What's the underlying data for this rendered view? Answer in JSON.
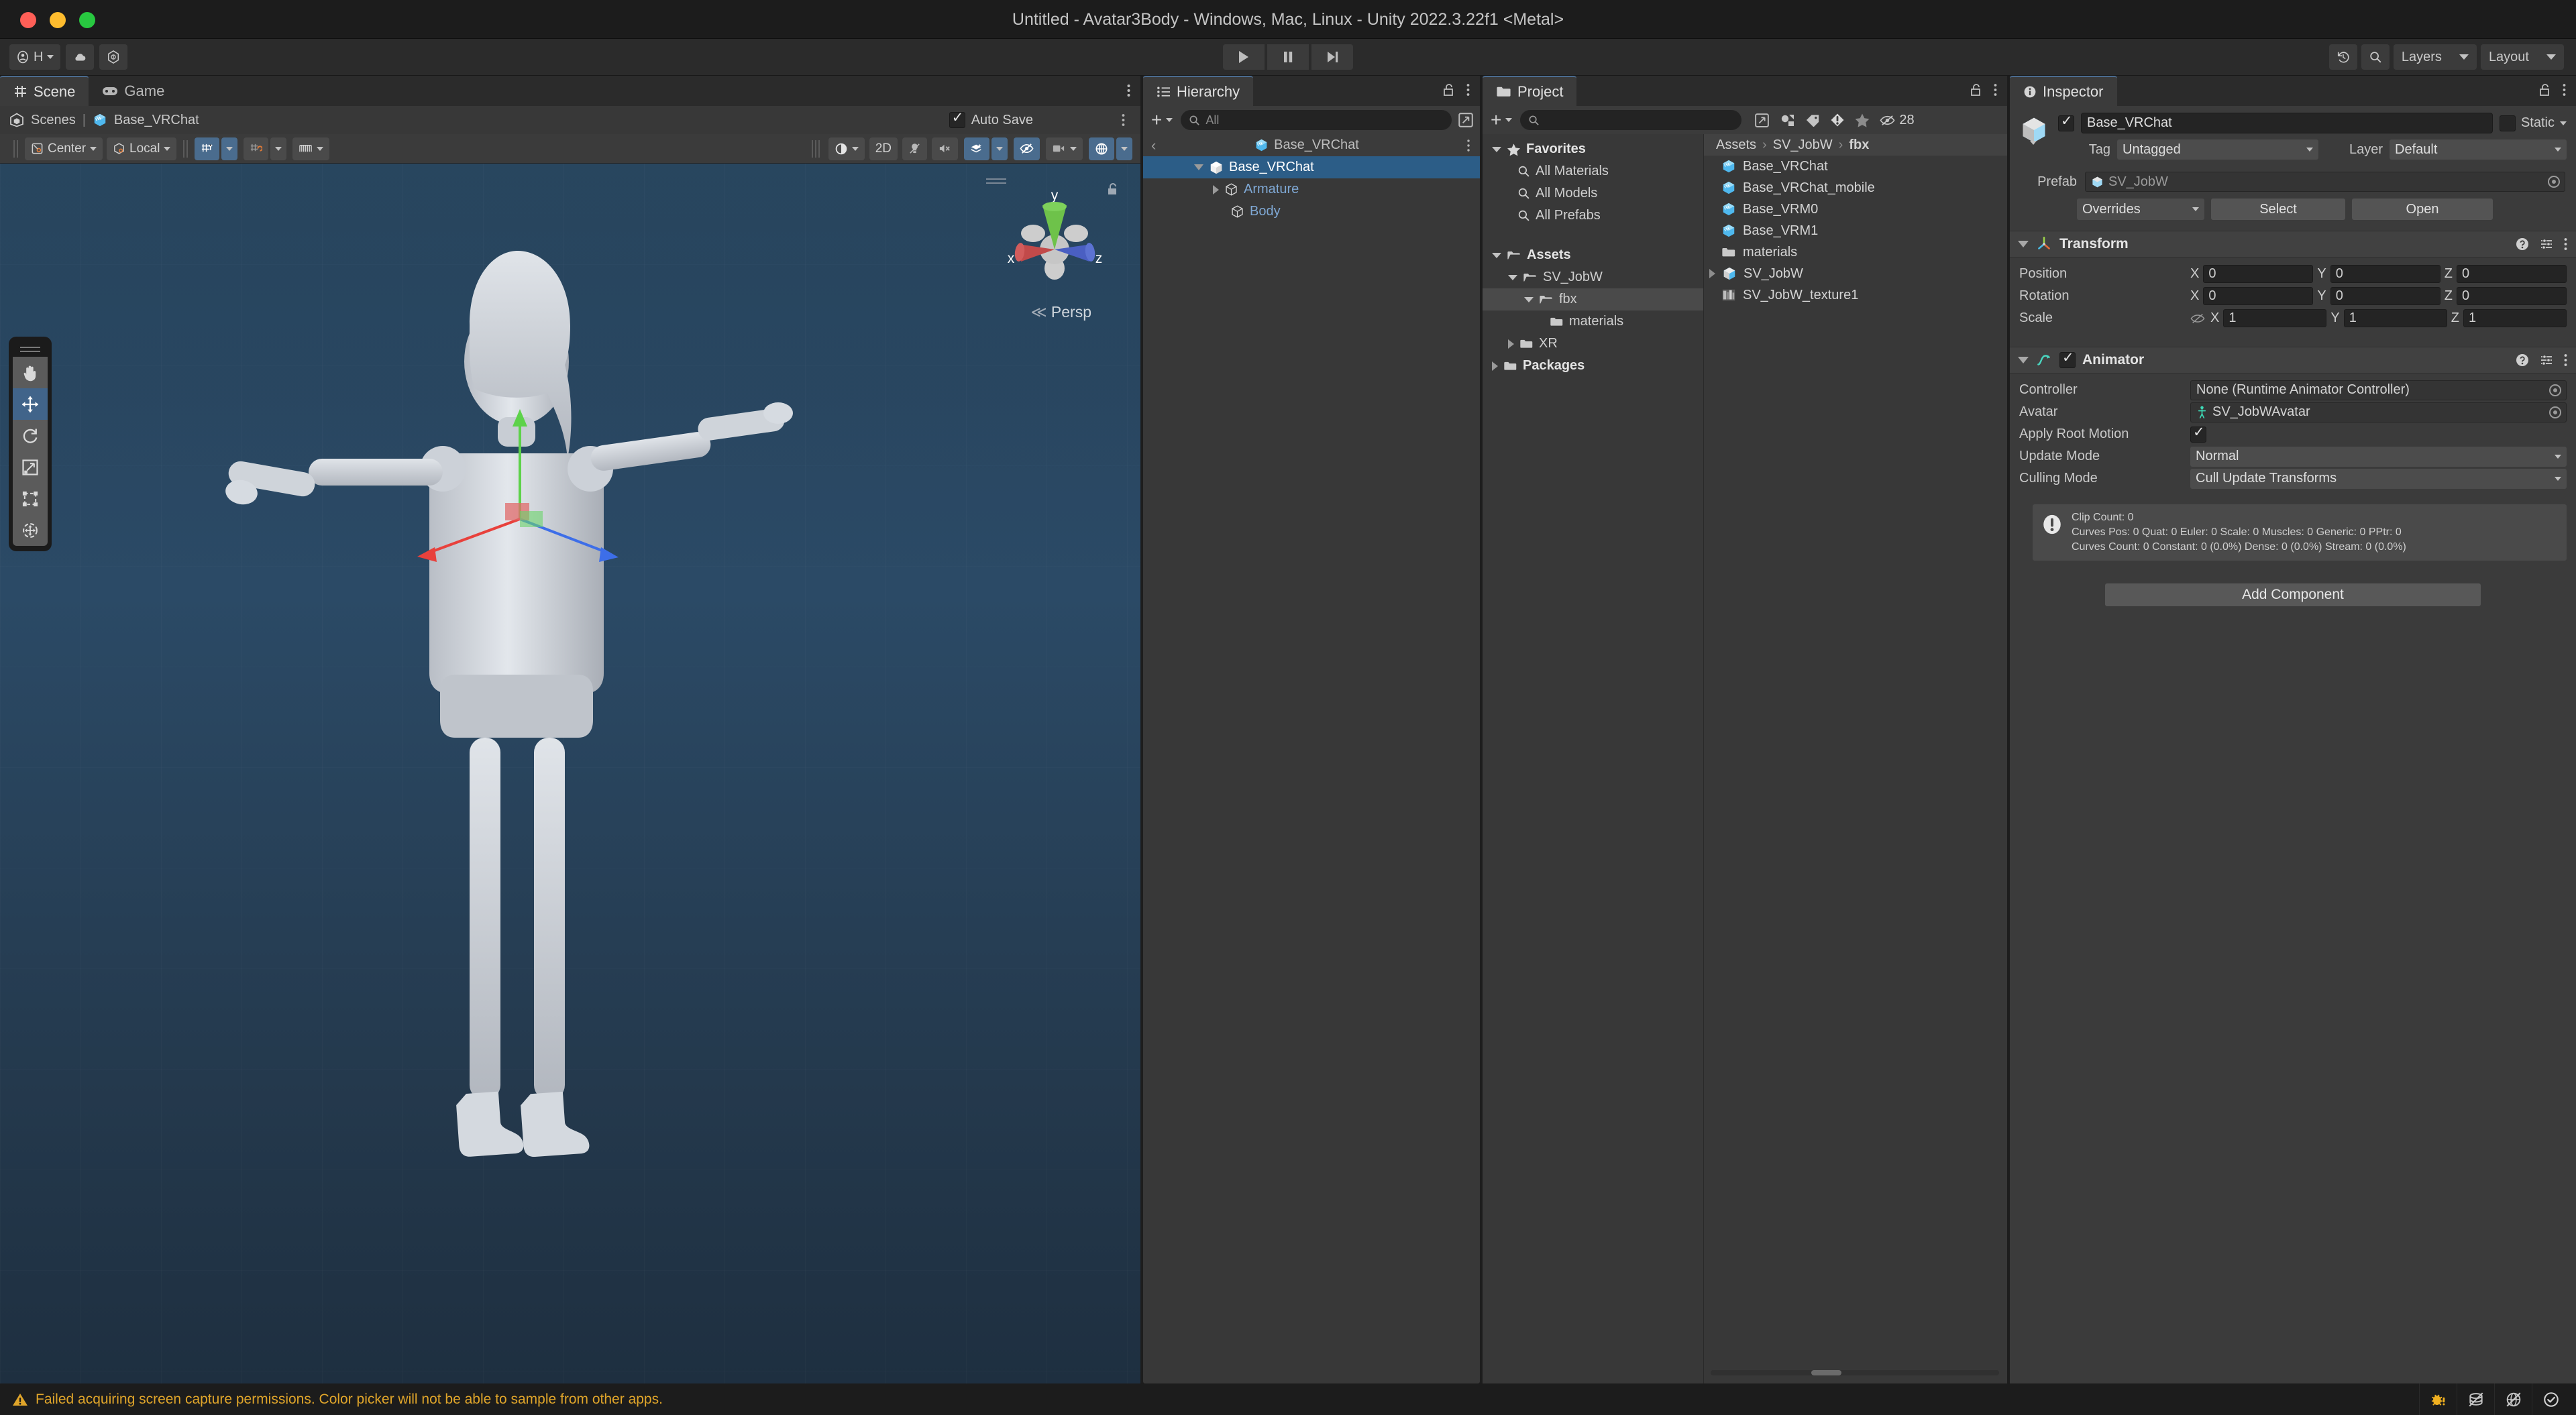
{
  "window": {
    "title": "Untitled - Avatar3Body - Windows, Mac, Linux - Unity 2022.3.22f1 <Metal>"
  },
  "toolbar": {
    "account_label": "H",
    "cloud_icon": "cloud-icon",
    "services_icon": "unity-services-icon",
    "play_icon": "play-icon",
    "pause_icon": "pause-icon",
    "step_icon": "step-icon",
    "history_icon": "undo-history-icon",
    "search_icon": "search-icon",
    "layers_label": "Layers",
    "layout_label": "Layout"
  },
  "scene": {
    "tabs": [
      {
        "label": "Scene",
        "icon": "scene-grid-icon",
        "active": true
      },
      {
        "label": "Game",
        "icon": "gamepad-icon",
        "active": false
      }
    ],
    "breadcrumb": {
      "scenes": "Scenes",
      "separator": "|",
      "current": "Base_VRChat"
    },
    "auto_save_label": "Auto Save",
    "auto_save_checked": true,
    "pivot_label": "Center",
    "space_label": "Local",
    "two_d_label": "2D",
    "persp_label": "Persp",
    "gizmo_axes": {
      "x": "x",
      "y": "y",
      "z": "z"
    },
    "tools": [
      {
        "name": "hand-tool",
        "active": false
      },
      {
        "name": "move-tool",
        "active": true
      },
      {
        "name": "rotate-tool",
        "active": false
      },
      {
        "name": "scale-tool",
        "active": false
      },
      {
        "name": "rect-tool",
        "active": false
      },
      {
        "name": "transform-tool",
        "active": false
      }
    ],
    "view_toggles": [
      {
        "name": "shading-mode",
        "active": false
      },
      {
        "name": "2d-toggle",
        "active": false
      },
      {
        "name": "lighting-toggle",
        "active": false
      },
      {
        "name": "audio-toggle",
        "active": false
      },
      {
        "name": "fx-toggle",
        "active": true
      },
      {
        "name": "hidden-objects-toggle",
        "active": true
      },
      {
        "name": "camera-toggle",
        "active": false
      },
      {
        "name": "gizmos-toggle",
        "active": true
      }
    ]
  },
  "hierarchy": {
    "tab_label": "Hierarchy",
    "search_placeholder": "All",
    "rows": [
      {
        "label": "Base_VRChat",
        "type": "scene",
        "depth": 0,
        "selected": false,
        "expandable": false
      },
      {
        "label": "Base_VRChat",
        "type": "prefab",
        "depth": 1,
        "selected": true,
        "expandable": true,
        "expanded": true
      },
      {
        "label": "Armature",
        "type": "gameobject",
        "depth": 2,
        "selected": false,
        "expandable": true,
        "expanded": false
      },
      {
        "label": "Body",
        "type": "gameobject",
        "depth": 2,
        "selected": false,
        "expandable": false
      }
    ]
  },
  "project": {
    "tab_label": "Project",
    "search_placeholder": "",
    "hidden_count": "28",
    "tree": [
      {
        "label": "Favorites",
        "depth": 0,
        "icon": "star-icon",
        "bold": true,
        "expanded": true
      },
      {
        "label": "All Materials",
        "depth": 1,
        "icon": "search-icon",
        "bold": false
      },
      {
        "label": "All Models",
        "depth": 1,
        "icon": "search-icon",
        "bold": false
      },
      {
        "label": "All Prefabs",
        "depth": 1,
        "icon": "search-icon",
        "bold": false
      },
      {
        "label": "Assets",
        "depth": 0,
        "icon": "folder-open-icon",
        "bold": true,
        "expanded": true
      },
      {
        "label": "SV_JobW",
        "depth": 1,
        "icon": "folder-open-icon",
        "bold": false,
        "expanded": true
      },
      {
        "label": "fbx",
        "depth": 2,
        "icon": "folder-open-icon",
        "bold": false,
        "expanded": true,
        "highlighted": true
      },
      {
        "label": "materials",
        "depth": 3,
        "icon": "folder-icon",
        "bold": false
      },
      {
        "label": "XR",
        "depth": 1,
        "icon": "folder-icon",
        "bold": false,
        "expanded": false
      },
      {
        "label": "Packages",
        "depth": 0,
        "icon": "folder-icon",
        "bold": true,
        "expanded": false
      }
    ],
    "breadcrumb": [
      "Assets",
      "SV_JobW",
      "fbx"
    ],
    "items": [
      {
        "label": "Base_VRChat",
        "icon": "model-icon",
        "expandable": false
      },
      {
        "label": "Base_VRChat_mobile",
        "icon": "model-icon",
        "expandable": false
      },
      {
        "label": "Base_VRM0",
        "icon": "model-icon",
        "expandable": false
      },
      {
        "label": "Base_VRM1",
        "icon": "model-icon",
        "expandable": false
      },
      {
        "label": "materials",
        "icon": "folder-icon",
        "expandable": false
      },
      {
        "label": "SV_JobW",
        "icon": "model-icon",
        "expandable": true
      },
      {
        "label": "SV_JobW_texture1",
        "icon": "texture-icon",
        "expandable": false
      }
    ]
  },
  "inspector": {
    "tab_label": "Inspector",
    "object_name": "Base_VRChat",
    "object_enabled": true,
    "static_label": "Static",
    "static_checked": false,
    "tag_label": "Tag",
    "tag_value": "Untagged",
    "layer_label": "Layer",
    "layer_value": "Default",
    "prefab_label": "Prefab",
    "prefab_value": "SV_JobW",
    "overrides_label": "Overrides",
    "select_label": "Select",
    "open_label": "Open",
    "add_component_label": "Add Component",
    "transform": {
      "title": "Transform",
      "rows": [
        {
          "label": "Position",
          "x": "0",
          "y": "0",
          "z": "0"
        },
        {
          "label": "Rotation",
          "x": "0",
          "y": "0",
          "z": "0"
        },
        {
          "label": "Scale",
          "x": "1",
          "y": "1",
          "z": "1",
          "link_icon": "constrain-proportions-off-icon"
        }
      ],
      "axis_labels": {
        "x": "X",
        "y": "Y",
        "z": "Z"
      }
    },
    "animator": {
      "title": "Animator",
      "enabled": true,
      "controller_label": "Controller",
      "controller_value": "None (Runtime Animator Controller)",
      "avatar_label": "Avatar",
      "avatar_value": "SV_JobWAvatar",
      "apply_root_motion_label": "Apply Root Motion",
      "apply_root_motion_checked": true,
      "update_mode_label": "Update Mode",
      "update_mode_value": "Normal",
      "culling_mode_label": "Culling Mode",
      "culling_mode_value": "Cull Update Transforms",
      "info_lines": [
        "Clip Count: 0",
        "Curves Pos: 0 Quat: 0 Euler: 0 Scale: 0 Muscles: 0 Generic: 0 PPtr: 0",
        "Curves Count: 0 Constant: 0 (0.0%) Dense: 0 (0.0%) Stream: 0 (0.0%)"
      ]
    }
  },
  "statusbar": {
    "message": "Failed acquiring screen capture permissions. Color picker will not be able to sample from other apps.",
    "warning_icon": "warning-triangle-icon",
    "right_icons": [
      "bug-icon",
      "no-cache-server-icon",
      "no-collab-icon",
      "ok-circle-icon"
    ]
  },
  "colors": {
    "accent_blue": "#2c5d87",
    "toolbar_bg": "#2b2b2b",
    "panel_bg": "#383838",
    "warning": "#e0a52a",
    "scene_bg": "#27425c"
  }
}
